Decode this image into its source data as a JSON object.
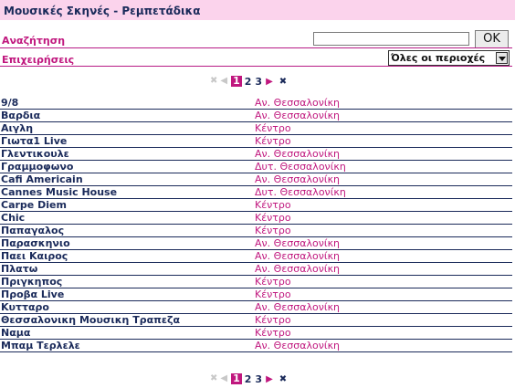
{
  "header": {
    "title": "Μουσικές Σκηνές - Ρεμπετάδικα"
  },
  "search": {
    "label": "Αναζήτηση",
    "value": "",
    "button": "OK"
  },
  "filter": {
    "label": "Επιχειρήσεις",
    "selected": "Όλες οι περιοχές"
  },
  "pager": {
    "current": "1",
    "pages": [
      "2",
      "3"
    ]
  },
  "colors": {
    "accent": "#c0177e",
    "header_bg": "#fbd3ec",
    "text": "#1a2a5a"
  },
  "rows": [
    {
      "name": "9/8",
      "area": "Αν. Θεσσαλονίκη"
    },
    {
      "name": "Βαρδια",
      "area": "Αν. Θεσσαλονίκη"
    },
    {
      "name": "Αιγλη",
      "area": "Κέντρο"
    },
    {
      "name": "Γιωτα1 Live",
      "area": "Κέντρο"
    },
    {
      "name": "Γλεντικουλε",
      "area": "Αν. Θεσσαλονίκη"
    },
    {
      "name": "Γραμμοφωνο",
      "area": "Δυτ. Θεσσαλονίκη"
    },
    {
      "name": "Cafi Americain",
      "area": "Αν. Θεσσαλονίκη"
    },
    {
      "name": "Cannes Music House",
      "area": "Δυτ. Θεσσαλονίκη"
    },
    {
      "name": "Carpe Diem",
      "area": "Κέντρο"
    },
    {
      "name": "Chic",
      "area": "Κέντρο"
    },
    {
      "name": "Παπαγαλος",
      "area": "Κέντρο"
    },
    {
      "name": "Παρασκηνιο",
      "area": "Αν. Θεσσαλονίκη"
    },
    {
      "name": "Παει Καιρος",
      "area": "Αν. Θεσσαλονίκη"
    },
    {
      "name": "Πλατω",
      "area": "Αν. Θεσσαλονίκη"
    },
    {
      "name": "Πριγκηπος",
      "area": "Κέντρο"
    },
    {
      "name": "Προβα Live",
      "area": "Κέντρο"
    },
    {
      "name": "Κυτταρο",
      "area": "Αν. Θεσσαλονίκη"
    },
    {
      "name": "Θεσσαλονικη Μουσικη Τραπεζα",
      "area": "Κέντρο"
    },
    {
      "name": "Ναμα",
      "area": "Κέντρο"
    },
    {
      "name": "Μπαμ Τερλελε",
      "area": "Αν. Θεσσαλονίκη"
    }
  ]
}
